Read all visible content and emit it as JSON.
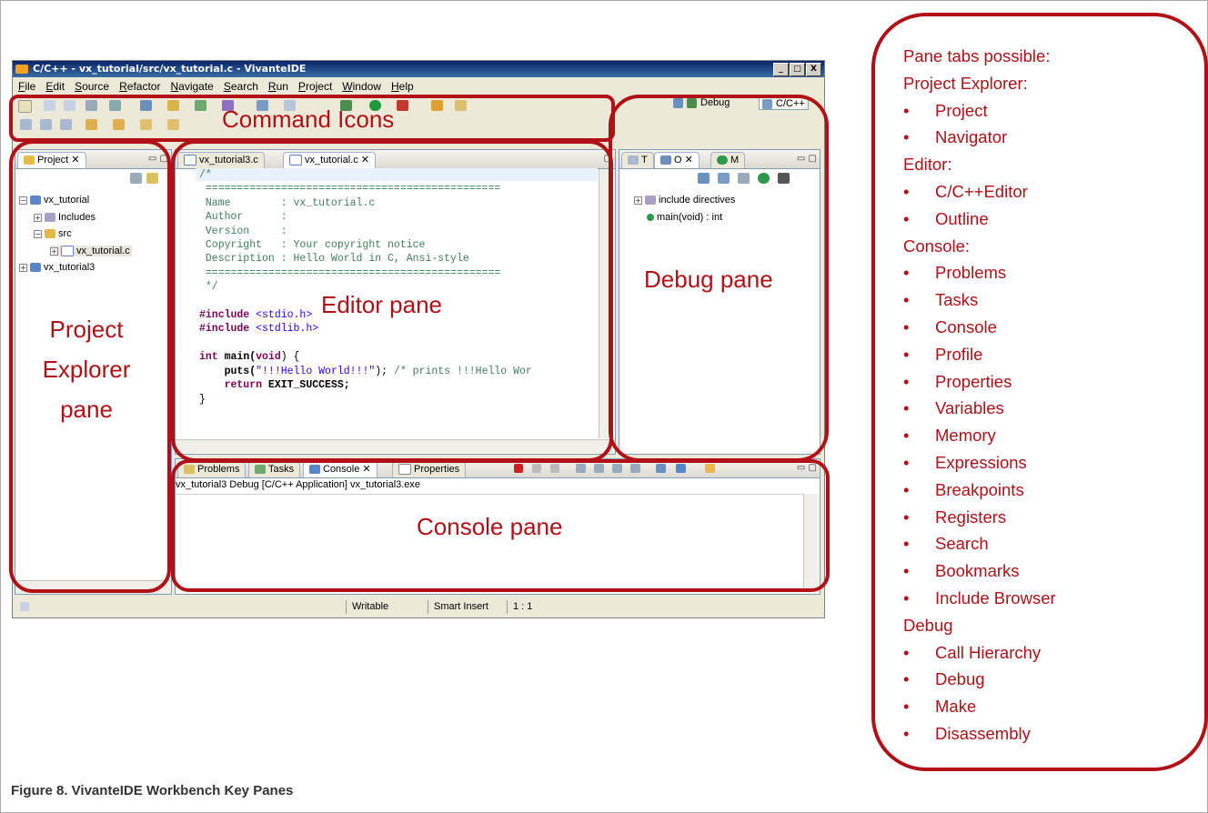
{
  "window": {
    "title": "C/C++ - vx_tutorial/src/vx_tutorial.c - VivanteIDE",
    "buttons": [
      "_",
      "□",
      "X"
    ]
  },
  "menu": [
    "File",
    "Edit",
    "Source",
    "Refactor",
    "Navigate",
    "Search",
    "Run",
    "Project",
    "Window",
    "Help"
  ],
  "perspectives": {
    "debug": "Debug",
    "cpp": "C/C++"
  },
  "project_explorer": {
    "tab": "Project",
    "tree": [
      {
        "label": "vx_tutorial",
        "level": 0
      },
      {
        "label": "Includes",
        "level": 1
      },
      {
        "label": "src",
        "level": 1
      },
      {
        "label": "vx_tutorial.c",
        "level": 2
      },
      {
        "label": "vx_tutorial3",
        "level": 0
      }
    ]
  },
  "editor": {
    "tabs": [
      "vx_tutorial3.c",
      "vx_tutorial.c"
    ],
    "code": {
      "l1": "/*",
      "l2": " ===============================================",
      "l3": " Name        : vx_tutorial.c",
      "l4": " Author      :",
      "l5": " Version     :",
      "l6": " Copyright   : Your copyright notice",
      "l7": " Description : Hello World in C, Ansi-style",
      "l8": " ===============================================",
      "l9": " */",
      "inc": "#include",
      "inc1": "<stdio.h>",
      "inc2": "<stdlib.h>",
      "int": "int",
      "main": " main(",
      "void": "void",
      "mainend": ") {",
      "puts": "    puts(",
      "putsstr": "\"!!!Hello World!!!\"",
      "putsend": "); ",
      "putscm": "/* prints !!!Hello Wor",
      "ret_kw": "    return",
      "ret": " EXIT_SUCCESS;",
      "close": "}"
    }
  },
  "outline": {
    "tabs": [
      "T",
      "O",
      "M"
    ],
    "items": [
      "include directives",
      "main(void) : int"
    ]
  },
  "console": {
    "tabs": [
      "Problems",
      "Tasks",
      "Console",
      "Properties"
    ],
    "header": "vx_tutorial3 Debug [C/C++ Application] vx_tutorial3.exe"
  },
  "status": {
    "writable": "Writable",
    "insert": "Smart Insert",
    "pos": "1 : 1"
  },
  "labels": {
    "command": "Command Icons",
    "explorer1": "Project",
    "explorer2": "Explorer",
    "explorer3": "pane",
    "editor": "Editor pane",
    "debug": "Debug pane",
    "console": "Console pane"
  },
  "tab_list": {
    "heading": "Pane tabs possible:",
    "groups": [
      {
        "name": "Project Explorer:",
        "items": [
          "Project",
          "Navigator"
        ]
      },
      {
        "name": "Editor:",
        "items": [
          "C/C++Editor",
          "Outline"
        ]
      },
      {
        "name": "Console:",
        "items": [
          "Problems",
          "Tasks",
          "Console",
          "Profile",
          "Properties",
          "Variables",
          "Memory",
          "Expressions",
          "Breakpoints",
          "Registers",
          "Search",
          "Bookmarks",
          "Include Browser"
        ]
      },
      {
        "name": "Debug",
        "items": [
          "Call Hierarchy",
          "Debug",
          "Make",
          "Disassembly"
        ]
      }
    ]
  },
  "caption": "Figure 8.  VivanteIDE Workbench Key Panes",
  "colors": {
    "annotation": "#b11116",
    "titlebar": "#0a246a",
    "chrome": "#ece9d8"
  }
}
